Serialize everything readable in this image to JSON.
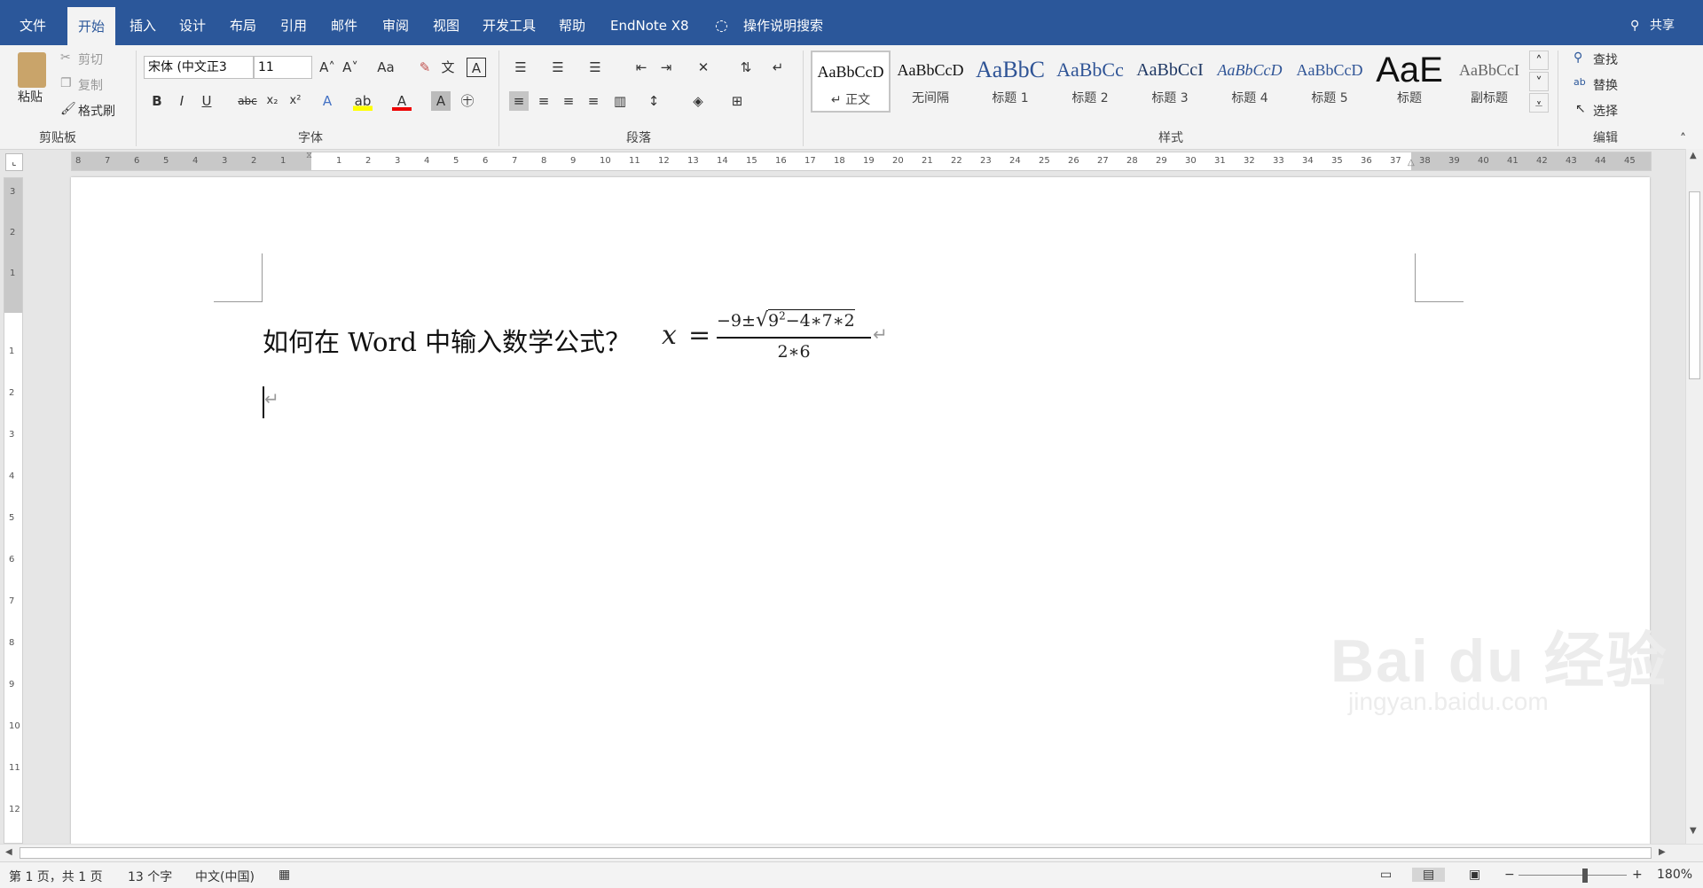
{
  "tabs": [
    "文件",
    "开始",
    "插入",
    "设计",
    "布局",
    "引用",
    "邮件",
    "审阅",
    "视图",
    "开发工具",
    "帮助",
    "EndNote X8"
  ],
  "tell_me": "操作说明搜索",
  "share": "共享",
  "clipboard": {
    "paste": "粘贴",
    "cut": "剪切",
    "copy": "复制",
    "format_painter": "格式刷",
    "label": "剪贴板"
  },
  "font": {
    "name": "宋体 (中文正3",
    "size": "11",
    "label": "字体",
    "case": "Aa"
  },
  "paragraph": {
    "label": "段落"
  },
  "styles": {
    "label": "样式",
    "items": [
      {
        "sample": "AaBbCcD",
        "name": "↵ 正文"
      },
      {
        "sample": "AaBbCcD",
        "name": "无间隔"
      },
      {
        "sample": "AaBbC",
        "name": "标题 1"
      },
      {
        "sample": "AaBbCc",
        "name": "标题 2"
      },
      {
        "sample": "AaBbCcI",
        "name": "标题 3"
      },
      {
        "sample": "AaBbCcD",
        "name": "标题 4"
      },
      {
        "sample": "AaBbCcD",
        "name": "标题 5"
      },
      {
        "sample": "AaE",
        "name": "标题"
      },
      {
        "sample": "AaBbCcI",
        "name": "副标题"
      }
    ]
  },
  "editing": {
    "find": "查找",
    "replace": "替换",
    "select": "选择",
    "label": "编辑"
  },
  "ruler": {
    "h_left": [
      "8",
      "7",
      "6",
      "5",
      "4",
      "3",
      "2",
      "1"
    ],
    "h_right": [
      "1",
      "2",
      "3",
      "4",
      "5",
      "6",
      "7",
      "8",
      "9",
      "10",
      "11",
      "12",
      "13",
      "14",
      "15",
      "16",
      "17",
      "18",
      "19",
      "20",
      "21",
      "22",
      "23",
      "24",
      "25",
      "26",
      "27",
      "28",
      "29",
      "30",
      "31",
      "32",
      "33",
      "34",
      "35",
      "36",
      "37",
      "38",
      "39",
      "40",
      "41",
      "42",
      "43",
      "44",
      "45"
    ],
    "v_top": [
      "3",
      "2",
      "1"
    ],
    "v_body": [
      "1",
      "2",
      "3",
      "4",
      "5",
      "6",
      "7",
      "8",
      "9",
      "10",
      "11",
      "12"
    ]
  },
  "document": {
    "text": "如何在 Word 中输入数学公式？",
    "eq_var": "x",
    "eq_equals": "=",
    "numerator_pre": "−9±",
    "radicand": "9",
    "exponent": "2",
    "numerator_post": "−4∗7∗2",
    "denominator": "2∗6",
    "para_mark": "↵"
  },
  "status": {
    "page": "第 1 页，共 1 页",
    "words": "13 个字",
    "lang": "中文(中国)",
    "zoom": "180%"
  },
  "watermark": {
    "brand": "Bai du 经验",
    "url": "jingyan.baidu.com"
  }
}
